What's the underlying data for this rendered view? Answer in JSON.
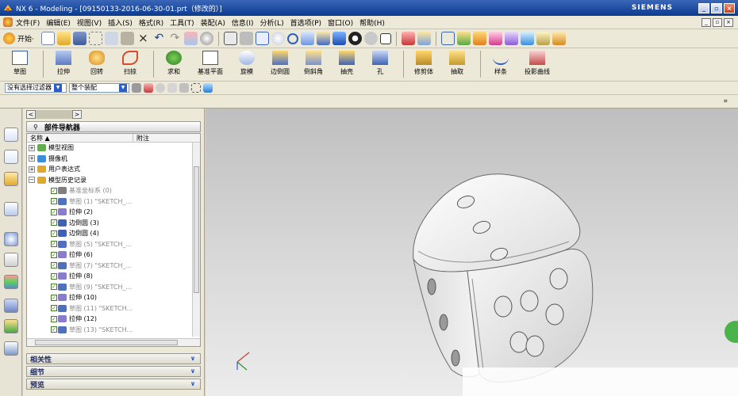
{
  "window": {
    "title": "NX 6 - Modeling - [09150133-2016-06-30-01.prt（修改的）]",
    "brand": "SIEMENS",
    "min": "_",
    "max": "▫",
    "close": "×"
  },
  "menu": {
    "items": [
      "文件(F)",
      "编辑(E)",
      "视图(V)",
      "插入(S)",
      "格式(R)",
      "工具(T)",
      "装配(A)",
      "信息(I)",
      "分析(L)",
      "首选项(P)",
      "窗口(O)",
      "帮助(H)"
    ]
  },
  "standard_toolbar": {
    "start_label": "开始·"
  },
  "feature_toolbar": {
    "items": [
      "草图",
      "拉伸",
      "回转",
      "扫掠",
      "求和",
      "基准平面",
      "旋模",
      "边倒圆",
      "倒斜角",
      "抽壳",
      "孔",
      "修剪体",
      "抽取",
      "样条",
      "投影曲线"
    ]
  },
  "selection_bar": {
    "filter": "没有选择过滤器",
    "scope": "整个装配"
  },
  "navigator": {
    "title": "部件导航器",
    "col_name": "名称 ▲",
    "col_attach": "附注",
    "tree": [
      {
        "label": "模型视图",
        "level": 0,
        "expand": "+"
      },
      {
        "label": "摄像机",
        "level": 0,
        "expand": "+"
      },
      {
        "label": "用户表达式",
        "level": 0,
        "expand": "+"
      },
      {
        "label": "模型历史记录",
        "level": 0,
        "expand": "−"
      },
      {
        "label": "基准坐标系 (0)",
        "level": 1,
        "dim": true
      },
      {
        "label": "草图 (1) \"SKETCH_...",
        "level": 1,
        "dim": true
      },
      {
        "label": "拉伸 (2)",
        "level": 1
      },
      {
        "label": "边倒圆 (3)",
        "level": 1
      },
      {
        "label": "边倒圆 (4)",
        "level": 1
      },
      {
        "label": "草图 (5) \"SKETCH_...",
        "level": 1,
        "dim": true
      },
      {
        "label": "拉伸 (6)",
        "level": 1
      },
      {
        "label": "草图 (7) \"SKETCH_...",
        "level": 1,
        "dim": true
      },
      {
        "label": "拉伸 (8)",
        "level": 1
      },
      {
        "label": "草图 (9) \"SKETCH_...",
        "level": 1,
        "dim": true
      },
      {
        "label": "拉伸 (10)",
        "level": 1
      },
      {
        "label": "草图 (11) \"SKETCH...",
        "level": 1,
        "dim": true
      },
      {
        "label": "拉伸 (12)",
        "level": 1
      },
      {
        "label": "草图 (13) \"SKETCH...",
        "level": 1,
        "dim": true
      }
    ],
    "panels": [
      "相关性",
      "细节",
      "预览"
    ]
  }
}
